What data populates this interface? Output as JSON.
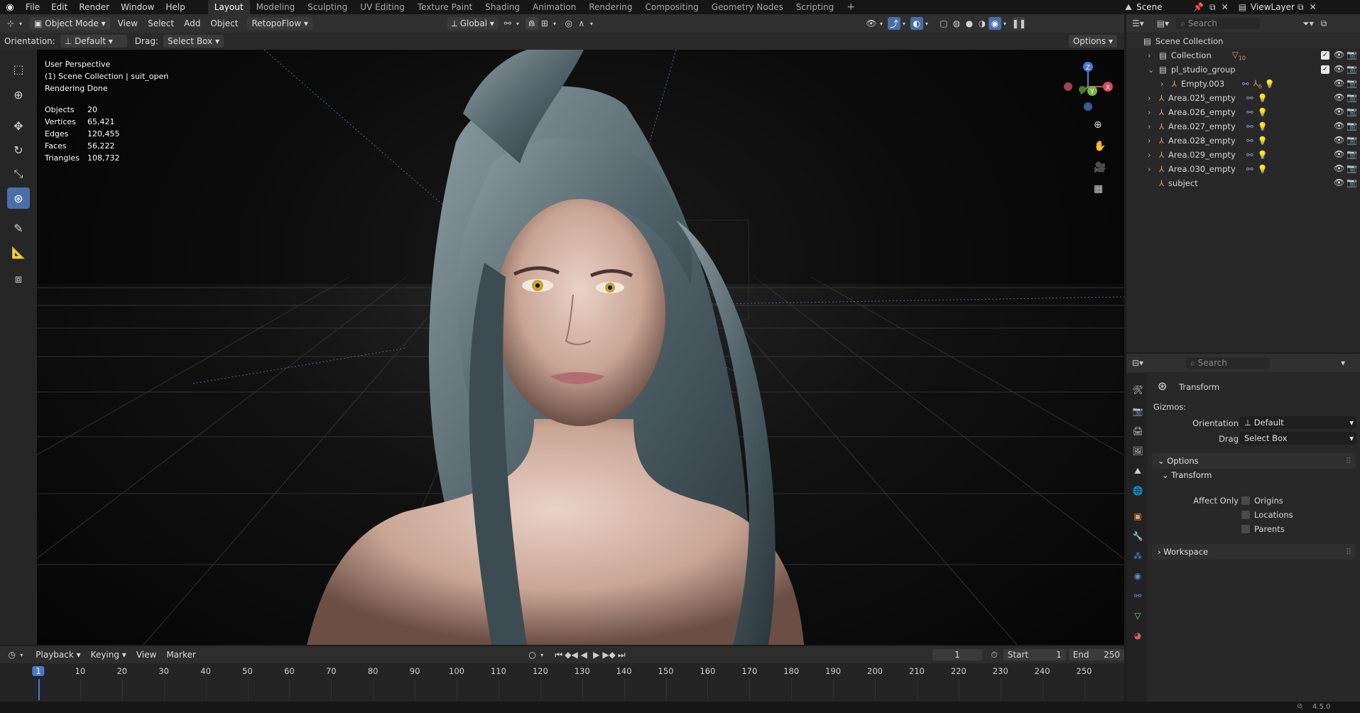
{
  "topbar": {
    "menus": [
      "File",
      "Edit",
      "Render",
      "Window",
      "Help"
    ],
    "workspaces": [
      "Layout",
      "Modeling",
      "Sculpting",
      "UV Editing",
      "Texture Paint",
      "Shading",
      "Animation",
      "Rendering",
      "Compositing",
      "Geometry Nodes",
      "Scripting"
    ],
    "active_workspace": "Layout",
    "scene": "Scene",
    "view_layer": "ViewLayer"
  },
  "viewport_header": {
    "mode": "Object Mode",
    "menus": [
      "View",
      "Select",
      "Add",
      "Object"
    ],
    "addon_menu": "RetopoFlow",
    "transform_orientation": "Global",
    "orientation_label": "Orientation:",
    "orientation_value": "Default",
    "drag_label": "Drag:",
    "drag_value": "Select Box",
    "options": "Options"
  },
  "viewport": {
    "perspective": "User Perspective",
    "collection_line": "(1) Scene Collection | suit_open",
    "status": "Rendering Done",
    "stats": [
      {
        "label": "Objects",
        "value": "20"
      },
      {
        "label": "Vertices",
        "value": "65,421"
      },
      {
        "label": "Edges",
        "value": "120,455"
      },
      {
        "label": "Faces",
        "value": "56,222"
      },
      {
        "label": "Triangles",
        "value": "108,732"
      }
    ],
    "gizmo_axes": {
      "z": "Z",
      "x": "X",
      "y": "Y"
    }
  },
  "outliner": {
    "search_placeholder": "Search",
    "root": "Scene Collection",
    "rows": [
      {
        "name": "Collection",
        "badge": "10"
      },
      {
        "name": "pl_studio_group",
        "badge": ""
      },
      {
        "name": "Empty.003",
        "badge": "6"
      },
      {
        "name": "Area.025_empty",
        "badge": ""
      },
      {
        "name": "Area.026_empty",
        "badge": ""
      },
      {
        "name": "Area.027_empty",
        "badge": ""
      },
      {
        "name": "Area.028_empty",
        "badge": ""
      },
      {
        "name": "Area.029_empty",
        "badge": ""
      },
      {
        "name": "Area.030_empty",
        "badge": ""
      },
      {
        "name": "subject",
        "badge": ""
      }
    ]
  },
  "properties": {
    "search_placeholder": "Search",
    "title": "Transform",
    "gizmos_label": "Gizmos:",
    "orientation_label": "Orientation",
    "orientation_value": "Default",
    "drag_label": "Drag",
    "drag_value": "Select Box",
    "options_panel": "Options",
    "transform_subpanel": "Transform",
    "affect_only_label": "Affect Only",
    "affect_only": [
      "Origins",
      "Locations",
      "Parents"
    ],
    "workspace_panel": "Workspace"
  },
  "timeline": {
    "menus": [
      "Playback",
      "Keying",
      "View",
      "Marker"
    ],
    "current_frame": "1",
    "start_label": "Start",
    "start": "1",
    "end_label": "End",
    "end": "250",
    "ticks": [
      "1",
      "10",
      "20",
      "30",
      "40",
      "50",
      "60",
      "70",
      "80",
      "90",
      "100",
      "110",
      "120",
      "130",
      "140",
      "150",
      "160",
      "170",
      "180",
      "190",
      "200",
      "210",
      "220",
      "230",
      "240",
      "250"
    ]
  },
  "statusbar": {
    "version": "4.5.0"
  }
}
